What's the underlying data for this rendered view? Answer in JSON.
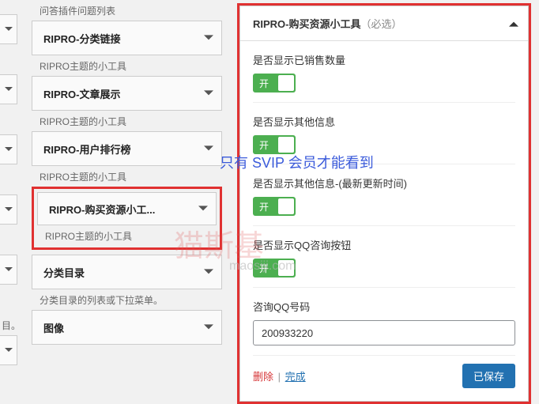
{
  "sidebar": {
    "sections": [
      {
        "label": "问答插件问题列表",
        "widget": "RIPRO-分类链接"
      },
      {
        "label": "RIPRO主题的小工具",
        "widget": "RIPRO-文章展示"
      },
      {
        "label": "RIPRO主题的小工具",
        "widget": "RIPRO-用户排行榜"
      },
      {
        "label": "RIPRO主题的小工具",
        "widget": "RIPRO-购买资源小工..."
      },
      {
        "label": "RIPRO主题的小工具",
        "widget": "分类目录",
        "after_label_override": true
      },
      {
        "label": "分类目录的列表或下拉菜单。",
        "widget": "图像"
      }
    ],
    "mini_label": "目。"
  },
  "panel": {
    "title": "RIPRO-购买资源小工具",
    "title_suffix": "（必选）",
    "fields": {
      "show_sold_qty": {
        "label": "是否显示已销售数量",
        "toggle": "开"
      },
      "show_other_info": {
        "label": "是否显示其他信息",
        "toggle": "开"
      },
      "show_other_info_time": {
        "label": "是否显示其他信息-(最新更新时间)",
        "toggle": "开"
      },
      "show_qq_button": {
        "label": "是否显示QQ咨询按钮",
        "toggle": "开"
      },
      "qq_number": {
        "label": "咨询QQ号码",
        "value": "200933220"
      }
    },
    "footer": {
      "delete": "删除",
      "done": "完成",
      "saved": "已保存"
    }
  },
  "watermark": {
    "svip": "只有 SVIP 会员才能看到",
    "brand": "猫斯基",
    "url": "maosiji.com"
  }
}
